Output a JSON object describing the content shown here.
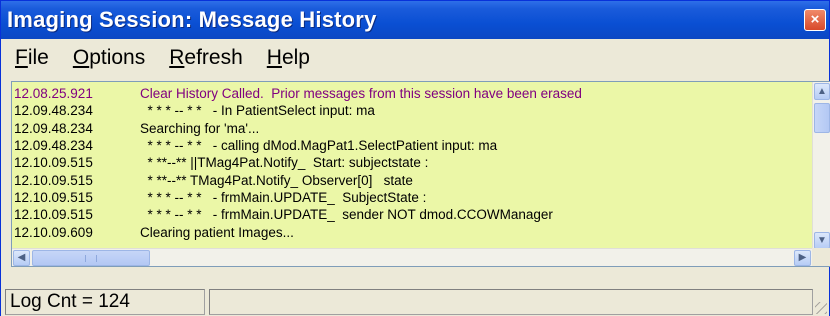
{
  "window": {
    "title": "Imaging Session:  Message History",
    "close_label": "×"
  },
  "menu": [
    {
      "accel": "F",
      "rest": "ile"
    },
    {
      "accel": "O",
      "rest": "ptions"
    },
    {
      "accel": "R",
      "rest": "efresh"
    },
    {
      "accel": "H",
      "rest": "elp"
    }
  ],
  "log": [
    {
      "time": "12.08.25.921",
      "message": "Clear History Called.  Prior messages from this session have been erased",
      "highlight": true
    },
    {
      "time": "12.09.48.234",
      "message": "  * * * -- * *   - In PatientSelect input: ma",
      "highlight": false
    },
    {
      "time": "12.09.48.234",
      "message": "Searching for 'ma'...",
      "highlight": false
    },
    {
      "time": "12.09.48.234",
      "message": "  * * * -- * *   - calling dMod.MagPat1.SelectPatient input: ma",
      "highlight": false
    },
    {
      "time": "12.10.09.515",
      "message": "  * **--** ||TMag4Pat.Notify_  Start: subjectstate :",
      "highlight": false
    },
    {
      "time": "12.10.09.515",
      "message": "  * **--** TMag4Pat.Notify_ Observer[0]   state",
      "highlight": false
    },
    {
      "time": "12.10.09.515",
      "message": "  * * * -- * *   - frmMain.UPDATE_  SubjectState :",
      "highlight": false
    },
    {
      "time": "12.10.09.515",
      "message": "  * * * -- * *   - frmMain.UPDATE_  sender NOT dmod.CCOWManager",
      "highlight": false
    },
    {
      "time": "12.10.09.609",
      "message": "Clearing patient Images...",
      "highlight": false
    }
  ],
  "scrollbars": {
    "up_glyph": "▲",
    "down_glyph": "▼",
    "left_glyph": "◀",
    "right_glyph": "▶"
  },
  "status": {
    "log_count": "Log Cnt = 124"
  }
}
